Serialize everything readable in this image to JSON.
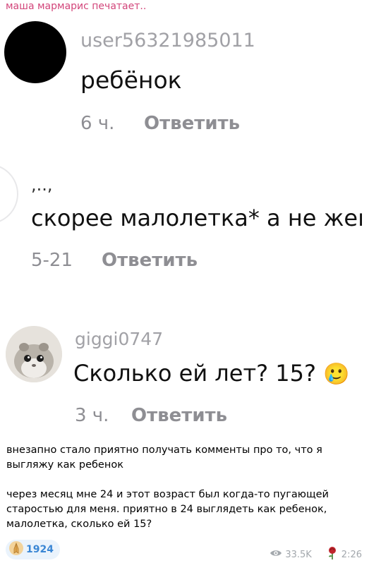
{
  "header": {
    "typing_text": "маша мармарис печатает.."
  },
  "comments": [
    {
      "username": "user56321985011",
      "text": "ребёнок",
      "time": "6 ч.",
      "reply_label": "Ответить"
    },
    {
      "username": ",..,",
      "text": "скорее малолетка* а не жеı",
      "time": "5-21",
      "reply_label": "Ответить"
    },
    {
      "username": "giggi0747",
      "text": "Сколько ей лет? 15?",
      "emoji": "🥲",
      "time": "3 ч.",
      "reply_label": "Ответить"
    }
  ],
  "post": {
    "paragraph1": "внезапно стало приятно получать комменты про то, что я выгляжу как ребенок",
    "paragraph2": "через месяц мне 24 и этот возраст был когда-то пугающей старостью для меня.  приятно в 24 выглядеть как ребенок, малолетка, сколько ей 15?"
  },
  "reaction": {
    "icon": "praying-hands-icon",
    "count": "1924"
  },
  "footer": {
    "views": "33.5K",
    "time": "2:26",
    "views_icon": "eye-icon",
    "author_icon": "rose-icon"
  },
  "colors": {
    "typing": "#d2457a",
    "reaction_bg": "#eaf3fc",
    "reaction_text": "#3a86d4",
    "meta": "#a3a8ad"
  }
}
